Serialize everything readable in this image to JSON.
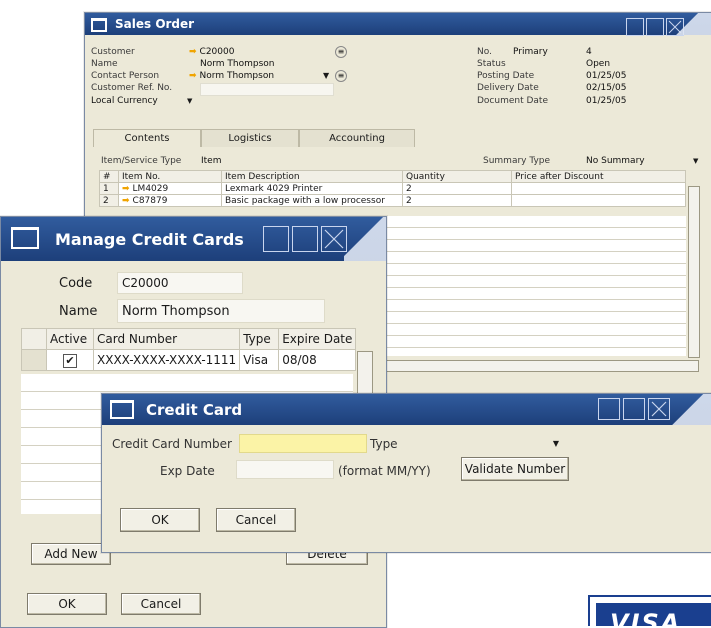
{
  "sales_order": {
    "title": "Sales Order",
    "fields_left": [
      {
        "label": "Customer",
        "value": "C20000"
      },
      {
        "label": "Name",
        "value": "Norm Thompson"
      },
      {
        "label": "Contact Person",
        "value": "Norm Thompson"
      },
      {
        "label": "Customer Ref. No.",
        "value": ""
      },
      {
        "label": "Local Currency",
        "value": ""
      }
    ],
    "fields_right": [
      {
        "label": "No.",
        "sub": "Primary",
        "value": "4"
      },
      {
        "label": "Status",
        "value": "Open"
      },
      {
        "label": "Posting Date",
        "value": "01/25/05"
      },
      {
        "label": "Delivery Date",
        "value": "02/15/05"
      },
      {
        "label": "Document Date",
        "value": "01/25/05"
      }
    ],
    "tabs": [
      "Contents",
      "Logistics",
      "Accounting"
    ],
    "item_service_type_label": "Item/Service Type",
    "item_service_type_value": "Item",
    "summary_type_label": "Summary Type",
    "summary_type_value": "No Summary",
    "columns": [
      "#",
      "Item No.",
      "Item Description",
      "Quantity",
      "Price after Discount"
    ],
    "rows": [
      {
        "num": "1",
        "item": "LM4029",
        "desc": "Lexmark 4029 Printer",
        "qty": "2"
      },
      {
        "num": "2",
        "item": "C87879",
        "desc": "Basic package with a low processor",
        "qty": "2"
      }
    ]
  },
  "manage_cc": {
    "title": "Manage Credit Cards",
    "code_label": "Code",
    "code_value": "C20000",
    "name_label": "Name",
    "name_value": "Norm Thompson",
    "columns": [
      "Active",
      "Card Number",
      "Type",
      "Expire Date"
    ],
    "row": {
      "card": "XXXX-XXXX-XXXX-1111",
      "type": "Visa",
      "exp": "08/08"
    },
    "add_new": "Add New",
    "delete": "Delete",
    "ok": "OK",
    "cancel": "Cancel"
  },
  "credit_card": {
    "title": "Credit Card",
    "cc_number_label": "Credit Card Number",
    "type_label": "Type",
    "exp_label": "Exp Date",
    "format_hint": "(format MM/YY)",
    "validate": "Validate Number",
    "ok": "OK",
    "cancel": "Cancel"
  },
  "visa_logo_text": "VISA"
}
